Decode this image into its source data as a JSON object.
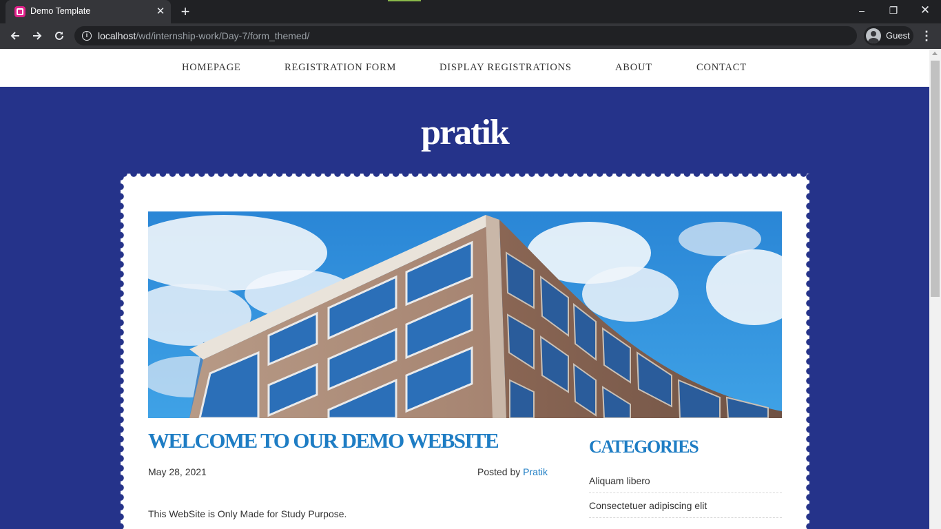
{
  "browser": {
    "tab_title": "Demo Template",
    "tab_close": "✕",
    "new_tab": "+",
    "url_host": "localhost",
    "url_path": "/wd/internship-work/Day-7/form_themed/",
    "profile_label": "Guest",
    "window_controls": {
      "minimize": "–",
      "maximize": "❐",
      "close": "✕"
    }
  },
  "site": {
    "nav": [
      {
        "label": "HOMEPAGE"
      },
      {
        "label": "REGISTRATION FORM"
      },
      {
        "label": "DISPLAY REGISTRATIONS"
      },
      {
        "label": "ABOUT"
      },
      {
        "label": "CONTACT"
      }
    ],
    "title": "pratik"
  },
  "post": {
    "title": "WELCOME TO OUR DEMO WEBSITE",
    "date": "May 28, 2021",
    "posted_by": "Posted by",
    "author": "Pratik",
    "body": "This WebSite is Only Made for Study Purpose."
  },
  "sidebar": {
    "title": "CATEGORIES",
    "items": [
      {
        "label": "Aliquam libero"
      },
      {
        "label": "Consectetuer adipiscing elit"
      }
    ]
  },
  "colors": {
    "background": "#25338a",
    "accent": "#1e7dc4",
    "chrome_dark": "#202124",
    "chrome_mid": "#35363a"
  },
  "icons": [
    "favicon-icon",
    "close-icon",
    "plus-icon",
    "back-arrow-icon",
    "forward-arrow-icon",
    "reload-icon",
    "info-icon",
    "profile-icon",
    "kebab-menu-icon"
  ]
}
